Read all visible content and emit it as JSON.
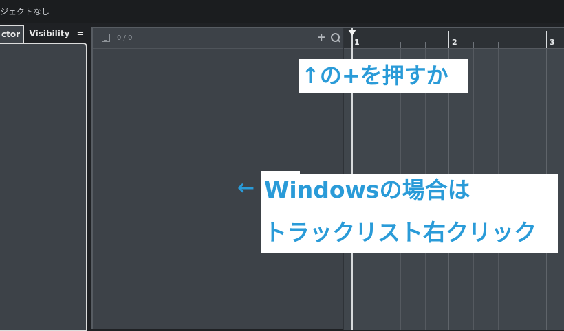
{
  "window": {
    "title": "ジェクトなし"
  },
  "left_panel": {
    "tabs": [
      {
        "label": "ctor",
        "active": true
      },
      {
        "label": "Visibility",
        "active": false
      }
    ],
    "menu_icon": "="
  },
  "track_list": {
    "count": "0 / 0",
    "add_icon": "+",
    "search_icon": "search-icon"
  },
  "ruler": {
    "bars": [
      "1",
      "2",
      "3"
    ]
  },
  "annotations": {
    "top": "↑の+を押すか",
    "arrow": "←",
    "line1": "Windowsの場合は",
    "line2": "トラックリスト右クリック"
  },
  "colors": {
    "background": "#3d4248",
    "annotation_text": "#2a9bd8",
    "annotation_bg": "#ffffff"
  }
}
